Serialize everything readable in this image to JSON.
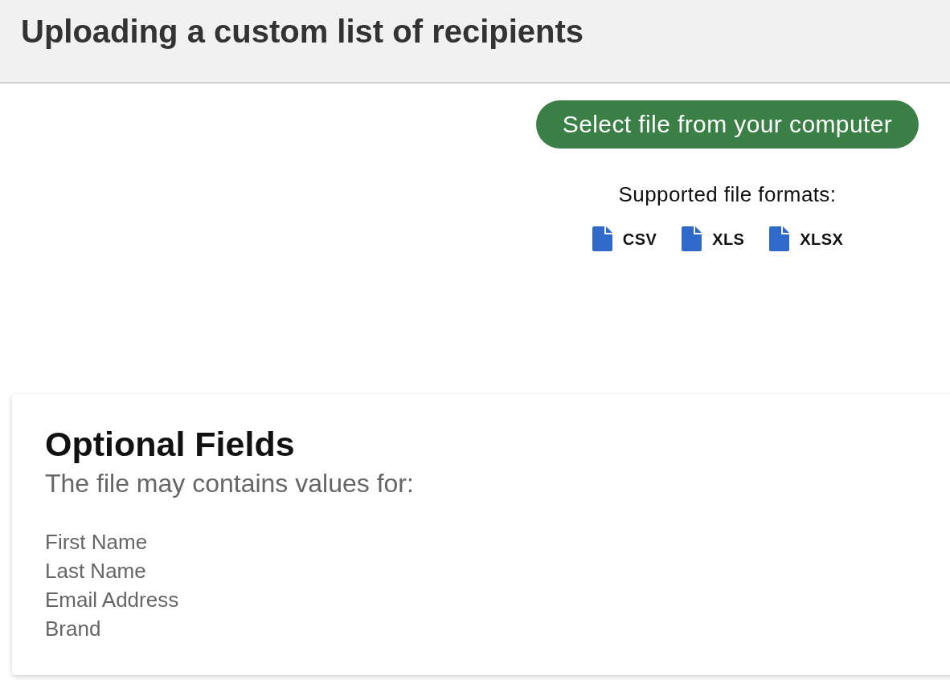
{
  "header": {
    "title": "Uploading a custom list of recipients"
  },
  "upload": {
    "button": "Select file from your computer",
    "formats_label": "Supported file formats:",
    "formats": [
      {
        "label": "CSV"
      },
      {
        "label": "XLS"
      },
      {
        "label": "XLSX"
      }
    ]
  },
  "optional_fields": {
    "title": "Optional Fields",
    "subtitle": "The file may contains values for:",
    "items": [
      "First Name",
      "Last Name",
      "Email Address",
      "Brand"
    ]
  }
}
